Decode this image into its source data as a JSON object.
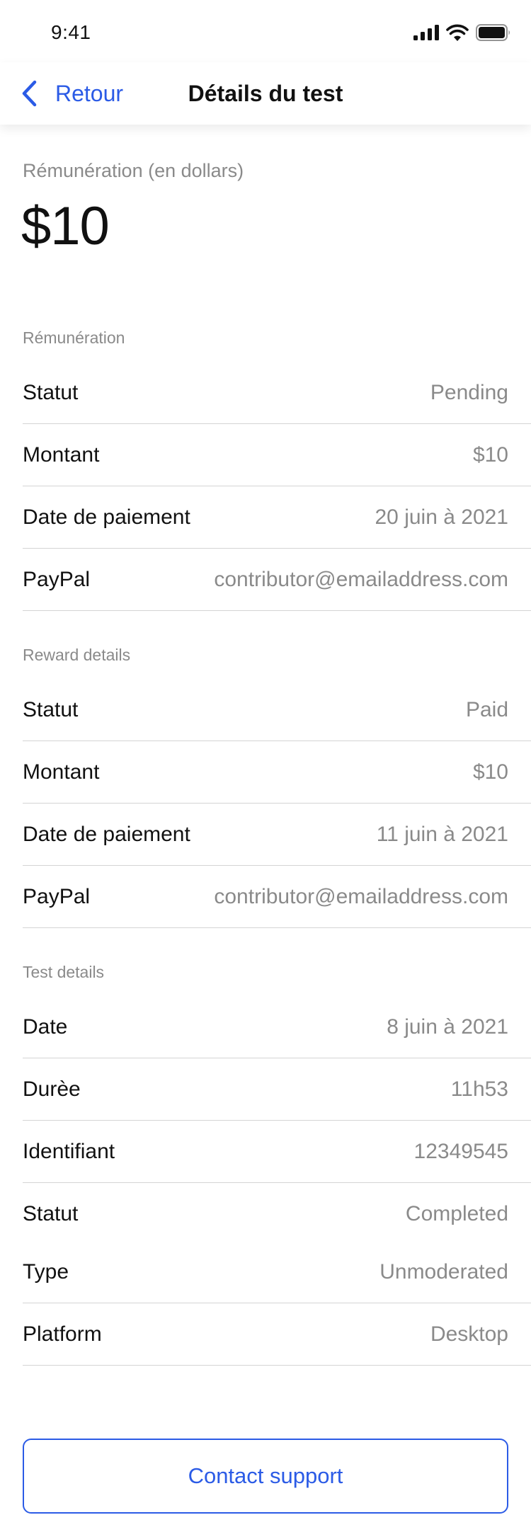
{
  "status_bar": {
    "time": "9:41",
    "icons": [
      "cellular-signal-icon",
      "wifi-icon",
      "battery-icon"
    ]
  },
  "nav": {
    "back_label": "Retour",
    "back_icon": "chevron-left-icon",
    "title": "Détails du test"
  },
  "summary": {
    "label": "Rémunération (en dollars)",
    "amount": "$10"
  },
  "sections": {
    "remuneration": {
      "title": "Rémunération",
      "rows": [
        {
          "label": "Statut",
          "value": "Pending"
        },
        {
          "label": "Montant",
          "value": "$10"
        },
        {
          "label": "Date de paiement",
          "value": "20 juin à 2021"
        },
        {
          "label": "PayPal",
          "value": "contributor@emailaddress.com"
        }
      ]
    },
    "reward": {
      "title": "Reward details",
      "rows": [
        {
          "label": "Statut",
          "value": "Paid"
        },
        {
          "label": "Montant",
          "value": "$10"
        },
        {
          "label": "Date de paiement",
          "value": "11 juin à 2021"
        },
        {
          "label": "PayPal",
          "value": "contributor@emailaddress.com"
        }
      ]
    },
    "test": {
      "title": "Test details",
      "rows": [
        {
          "label": "Date",
          "value": "8 juin à 2021"
        },
        {
          "label": "Durèe",
          "value": "11h53"
        },
        {
          "label": "Identifiant",
          "value": "12349545"
        },
        {
          "label": "Statut",
          "value": "Completed"
        },
        {
          "label": "Type",
          "value": "Unmoderated"
        },
        {
          "label": "Platform",
          "value": "Desktop"
        }
      ]
    }
  },
  "support_button": {
    "label": "Contact support"
  },
  "colors": {
    "accent": "#2b5be6",
    "text": "#111111",
    "secondary_text": "#8a8a8a",
    "divider": "#d4d4d4"
  }
}
